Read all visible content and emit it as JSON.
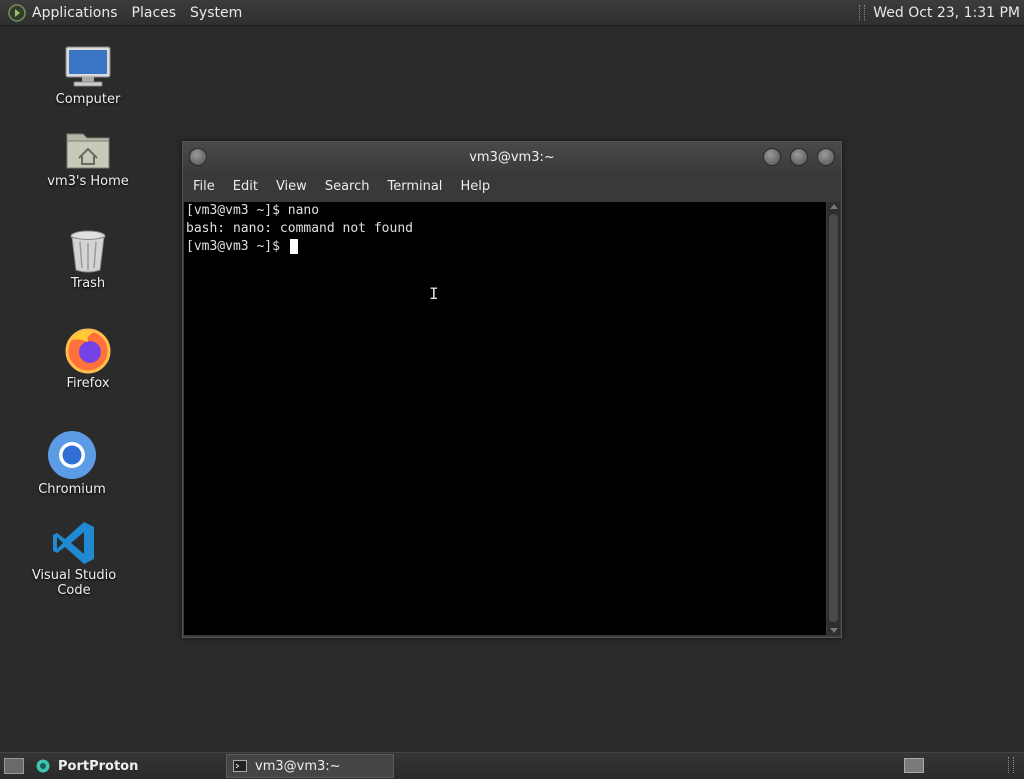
{
  "top_panel": {
    "menus": [
      "Applications",
      "Places",
      "System"
    ],
    "clock": "Wed Oct 23,  1:31 PM"
  },
  "desktop_icons": [
    {
      "label": "Computer",
      "icon": "computer-icon"
    },
    {
      "label": "vm3's Home",
      "icon": "home-folder-icon"
    },
    {
      "label": "Trash",
      "icon": "trash-icon"
    },
    {
      "label": "Firefox",
      "icon": "firefox-icon"
    },
    {
      "label": "Chromium",
      "icon": "chromium-icon"
    },
    {
      "label": "Visual Studio Code",
      "icon": "vscode-icon"
    }
  ],
  "terminal": {
    "title": "vm3@vm3:~",
    "menu": [
      "File",
      "Edit",
      "View",
      "Search",
      "Terminal",
      "Help"
    ],
    "lines": [
      "[vm3@vm3 ~]$ nano",
      "bash: nano: command not found",
      "[vm3@vm3 ~]$ "
    ]
  },
  "taskbar": {
    "tasks": [
      {
        "label": "PortProton",
        "icon": "portproton-icon"
      },
      {
        "label": "vm3@vm3:~",
        "icon": "terminal-icon"
      }
    ]
  },
  "colors": {
    "desktop_bg": "#2b2b2b",
    "terminal_bg": "#000000",
    "panel_bg": "#353535"
  }
}
